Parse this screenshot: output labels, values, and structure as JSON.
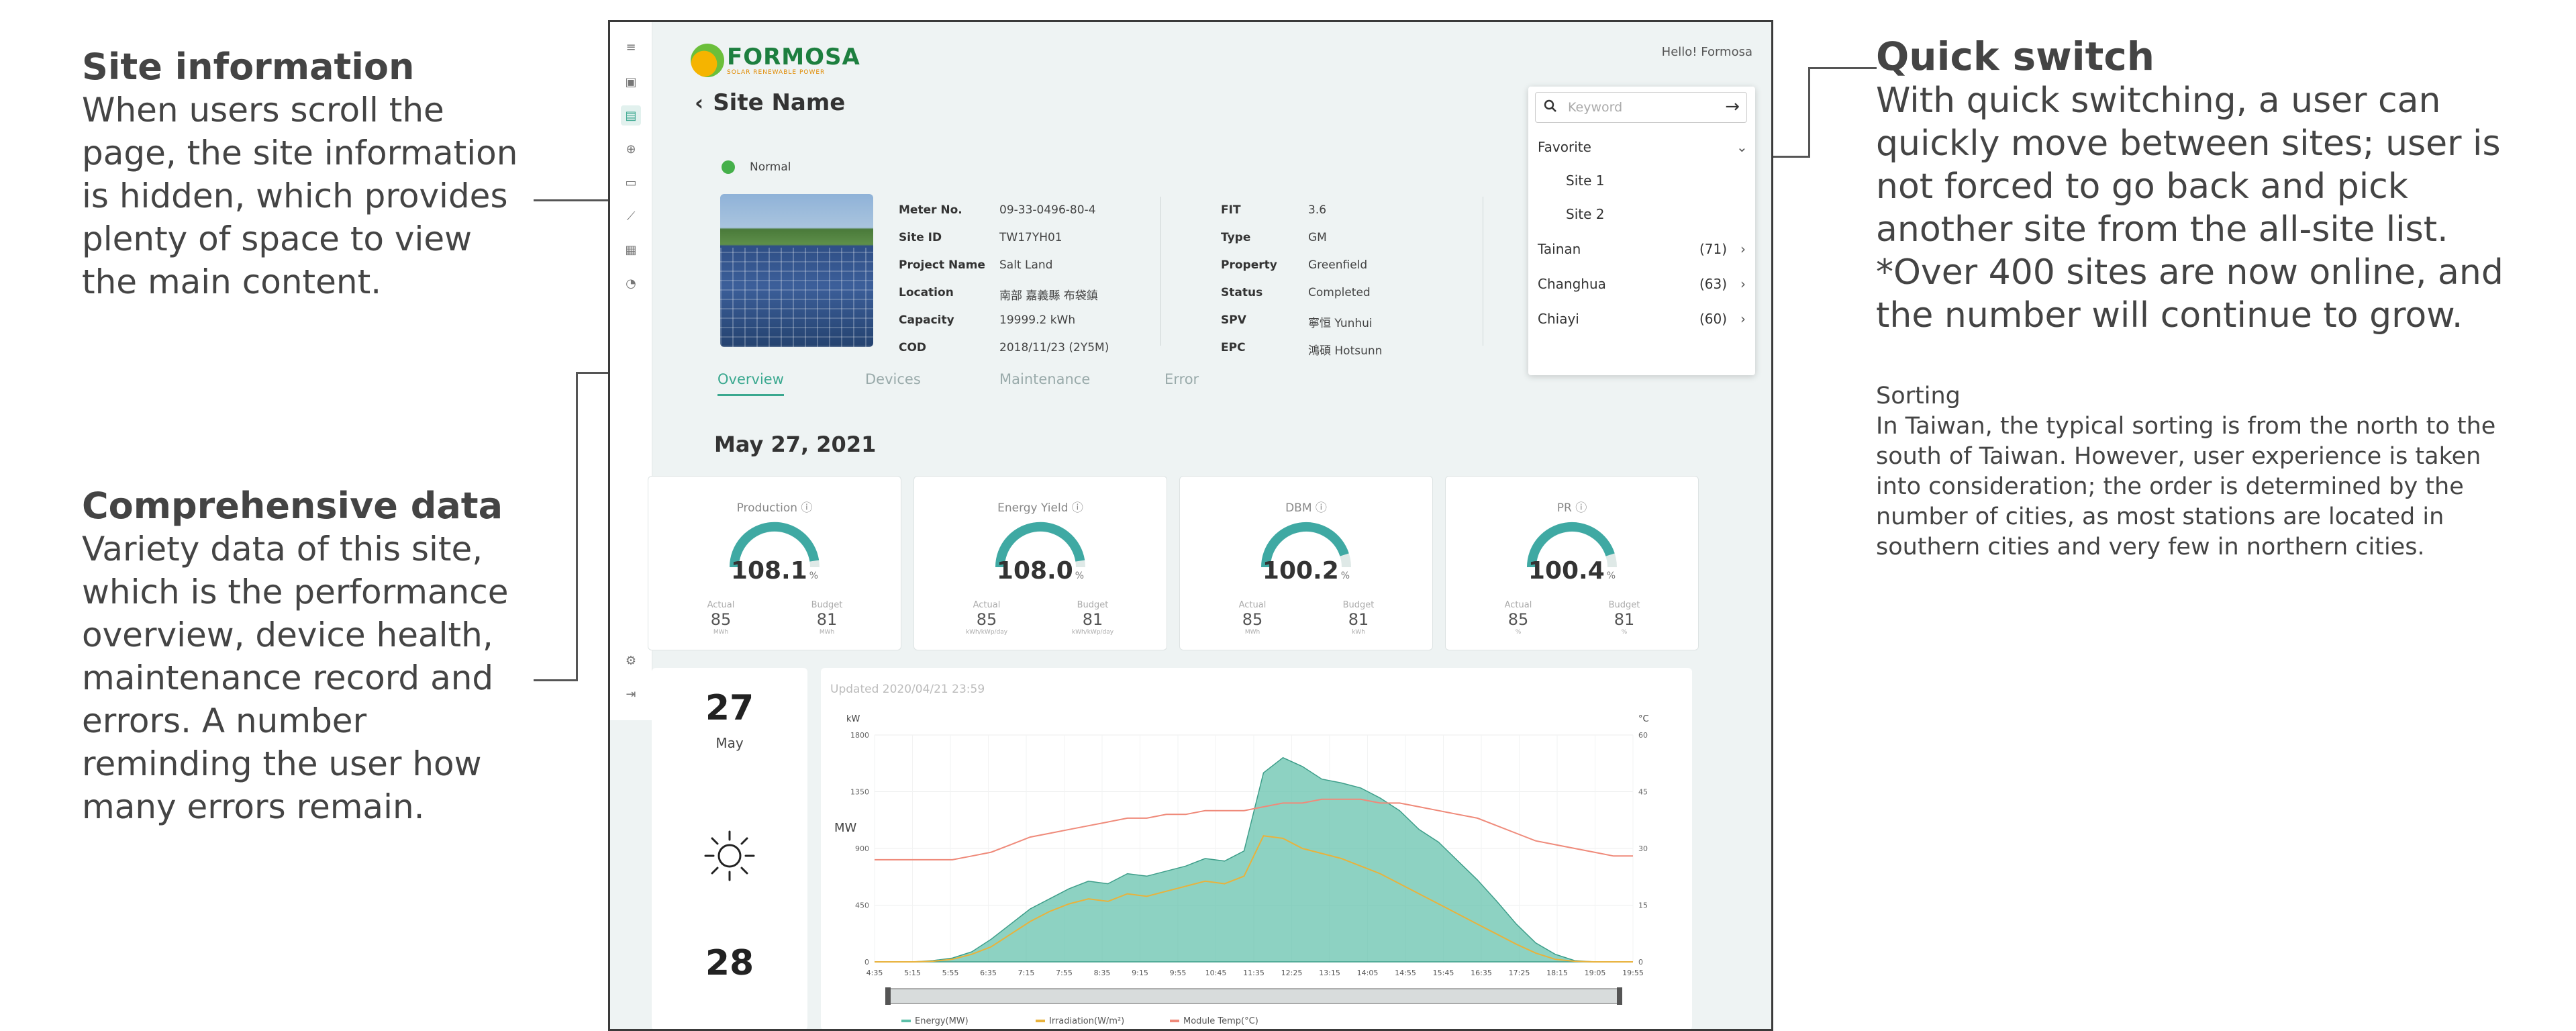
{
  "annotations": {
    "site_info": {
      "title": "Site information",
      "body": "When users scroll the page, the site information is hidden, which provides plenty of space to view the main content."
    },
    "comprehensive": {
      "title": "Comprehensive data",
      "body": "Variety data of this site, which is the performance overview, device health, maintenance record and errors. A number reminding the user how many errors remain."
    },
    "quick_switch": {
      "title": "Quick switch",
      "body": "With quick switching, a user can quickly move between sites; user is not forced to go back and pick another site from the all-site list. *Over 400 sites are now online, and the number will continue to grow."
    },
    "sorting": {
      "title": "Sorting",
      "body": "In Taiwan, the typical sorting is from the north to the south of Taiwan. However, user experience is taken into consideration; the order is determined by the number of cities, as most stations are located in southern cities and very few in northern cities."
    }
  },
  "app": {
    "logo": {
      "name": "FORMOSA",
      "tagline": "SOLAR RENEWABLE POWER"
    },
    "greeting": "Hello! Formosa",
    "page_title": "Site Name",
    "status": "Normal",
    "site_info": {
      "col1": [
        {
          "k": "Meter No.",
          "v": "09-33-0496-80-4"
        },
        {
          "k": "Site ID",
          "v": "TW17YH01"
        },
        {
          "k": "Project Name",
          "v": "Salt Land"
        },
        {
          "k": "Location",
          "v": "南部 嘉義縣 布袋鎮"
        },
        {
          "k": "Capacity",
          "v": "19999.2 kWh"
        },
        {
          "k": "COD",
          "v": "2018/11/23 (2Y5M)"
        }
      ],
      "col2": [
        {
          "k": "FIT",
          "v": "3.6"
        },
        {
          "k": "Type",
          "v": "GM"
        },
        {
          "k": "Property",
          "v": "Greenfield"
        },
        {
          "k": "Status",
          "v": "Completed"
        },
        {
          "k": "SPV",
          "v": "寧恒 Yunhui"
        },
        {
          "k": "EPC",
          "v": "鴻碩 Hotsunn"
        }
      ]
    },
    "tabs": [
      "Overview",
      "Devices",
      "Maintenance",
      "Error"
    ],
    "active_tab": "Overview",
    "date": "May 27, 2021",
    "kpis": [
      {
        "title": "Production",
        "percent": "108.1",
        "actual_label": "Actual",
        "actual": "85",
        "actual_unit": "MWh",
        "budget_label": "Budget",
        "budget": "81",
        "budget_unit": "MWh",
        "fill": 0.95
      },
      {
        "title": "Energy Yield",
        "percent": "108.0",
        "actual_label": "Actual",
        "actual": "85",
        "actual_unit": "kWh/kWp/day",
        "budget_label": "Budget",
        "budget": "81",
        "budget_unit": "kWh/kWp/day",
        "fill": 0.95
      },
      {
        "title": "DBM",
        "percent": "100.2",
        "actual_label": "Actual",
        "actual": "85",
        "actual_unit": "MWh",
        "budget_label": "Budget",
        "budget": "81",
        "budget_unit": "kWh",
        "fill": 0.9
      },
      {
        "title": "PR",
        "percent": "100.4",
        "actual_label": "Actual",
        "actual": "85",
        "actual_unit": "%",
        "budget_label": "Budget",
        "budget": "81",
        "budget_unit": "%",
        "fill": 0.9
      }
    ],
    "weather": {
      "day1": "27",
      "month1": "May",
      "day2": "28"
    },
    "updated": "Updated 2020/04/21 23:59",
    "quick_switch": {
      "placeholder": "Keyword",
      "favorite_label": "Favorite",
      "favorites": [
        "Site 1",
        "Site 2"
      ],
      "cities": [
        {
          "name": "Tainan",
          "count": "(71)"
        },
        {
          "name": "Changhua",
          "count": "(63)"
        },
        {
          "name": "Chiayi",
          "count": "(60)"
        }
      ]
    },
    "colors": {
      "accent": "#3aa88f",
      "energy": "#5cbfa8",
      "irradiation": "#e8b23c",
      "temp": "#ef8a7a"
    }
  },
  "chart_data": {
    "type": "area",
    "title": "",
    "xlabel": "",
    "ylabel_left": "kW",
    "ylabel_right": "°C",
    "y_inner_label": "MW",
    "y_ticks_left": [
      0,
      450,
      900,
      1350,
      1800
    ],
    "y_ticks_right": [
      0,
      15,
      30,
      45,
      60
    ],
    "ylim": [
      0,
      1800
    ],
    "ylim_right": [
      0,
      60
    ],
    "x": [
      "4:35",
      "4:55",
      "5:15",
      "5:35",
      "5:55",
      "6:15",
      "6:35",
      "6:55",
      "7:15",
      "7:35",
      "7:55",
      "8:15",
      "8:35",
      "8:55",
      "9:15",
      "9:35",
      "9:55",
      "10:15",
      "10:45",
      "11:15",
      "11:35",
      "11:55",
      "12:25",
      "12:55",
      "13:15",
      "13:45",
      "14:05",
      "14:35",
      "14:55",
      "15:15",
      "15:45",
      "16:05",
      "16:35",
      "16:55",
      "17:25",
      "17:45",
      "18:15",
      "18:35",
      "19:05",
      "19:55"
    ],
    "x_tick_labels": [
      "4:35",
      "5:15",
      "5:55",
      "6:35",
      "7:15",
      "7:55",
      "8:35",
      "9:15",
      "9:55",
      "10:45",
      "11:35",
      "12:25",
      "13:15",
      "14:05",
      "14:55",
      "15:45",
      "16:35",
      "17:25",
      "18:15",
      "19:05",
      "19:55"
    ],
    "series": [
      {
        "name": "Energy(MW)",
        "type": "area",
        "values": [
          0,
          0,
          0,
          10,
          30,
          80,
          180,
          300,
          420,
          500,
          580,
          640,
          620,
          700,
          680,
          720,
          760,
          820,
          800,
          880,
          1500,
          1620,
          1550,
          1450,
          1420,
          1380,
          1300,
          1200,
          1050,
          950,
          800,
          650,
          480,
          300,
          150,
          60,
          10,
          0,
          0,
          0
        ]
      },
      {
        "name": "Irradiation(W/m²)",
        "type": "line",
        "values": [
          0,
          0,
          0,
          5,
          20,
          60,
          120,
          220,
          320,
          400,
          460,
          500,
          480,
          540,
          520,
          560,
          600,
          640,
          620,
          680,
          1000,
          980,
          900,
          860,
          820,
          760,
          700,
          620,
          540,
          460,
          380,
          300,
          220,
          140,
          70,
          20,
          5,
          0,
          0,
          0
        ]
      },
      {
        "name": "Module Temp(°C)",
        "type": "line",
        "axis": "right",
        "values": [
          27,
          27,
          27,
          27,
          27,
          28,
          29,
          31,
          33,
          34,
          35,
          36,
          37,
          38,
          38,
          39,
          39,
          40,
          40,
          40,
          41,
          42,
          42,
          43,
          43,
          43,
          42,
          42,
          41,
          40,
          39,
          38,
          36,
          34,
          32,
          31,
          30,
          29,
          28,
          28
        ]
      }
    ]
  }
}
